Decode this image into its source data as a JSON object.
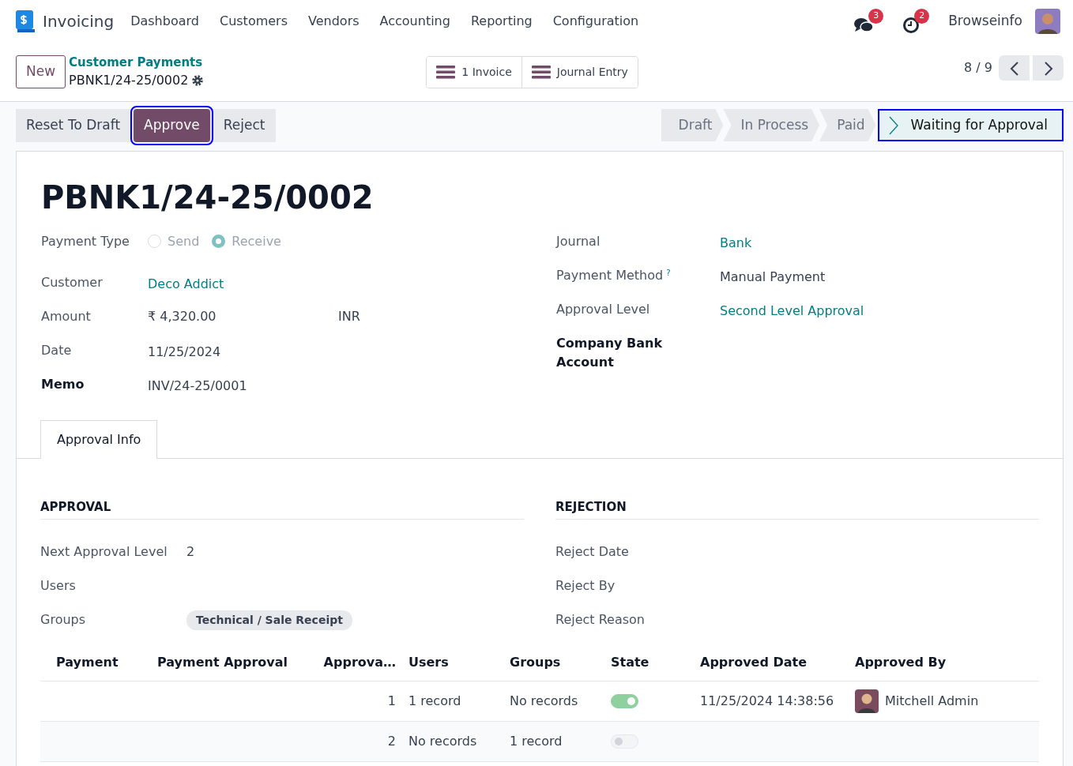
{
  "app": {
    "name": "Invoicing",
    "menu": [
      "Dashboard",
      "Customers",
      "Vendors",
      "Accounting",
      "Reporting",
      "Configuration"
    ]
  },
  "systray": {
    "messages_count": "3",
    "activities_count": "2",
    "company": "Browseinfo"
  },
  "control_panel": {
    "new_button": "New",
    "breadcrumb": "Customer Payments",
    "record": "PBNK1/24-25/0002",
    "smart_buttons": [
      "1 Invoice",
      "Journal Entry"
    ],
    "pager": "8 / 9"
  },
  "actions": [
    {
      "label": "Reset To Draft",
      "primary": false,
      "highlighted": false
    },
    {
      "label": "Approve",
      "primary": true,
      "highlighted": true
    },
    {
      "label": "Reject",
      "primary": false,
      "highlighted": false
    }
  ],
  "stages": [
    {
      "label": "Draft",
      "selected": false,
      "highlighted": false
    },
    {
      "label": "In Process",
      "selected": false,
      "highlighted": false
    },
    {
      "label": "Paid",
      "selected": false,
      "highlighted": false
    },
    {
      "label": "Waiting for Approval",
      "selected": true,
      "highlighted": true
    }
  ],
  "title": "PBNK1/24-25/0002",
  "left_fields": [
    {
      "kind": "radio",
      "label": "Payment Type",
      "options": [
        {
          "label": "Send",
          "selected": false
        },
        {
          "label": "Receive",
          "selected": true
        }
      ]
    },
    {
      "kind": "link",
      "label": "Customer",
      "value": "Deco Addict"
    },
    {
      "kind": "amount",
      "label": "Amount",
      "value": "₹ 4,320.00",
      "currency": "INR"
    },
    {
      "kind": "text",
      "label": "Date",
      "value": "11/25/2024"
    },
    {
      "kind": "text",
      "label": "Memo",
      "value": "INV/24-25/0001",
      "required": true
    }
  ],
  "right_fields": [
    {
      "kind": "link",
      "label": "Journal",
      "value": "Bank"
    },
    {
      "kind": "text",
      "label": "Payment Method",
      "help": "?",
      "value": "Manual Payment"
    },
    {
      "kind": "link",
      "label": "Approval Level",
      "value": "Second Level Approval"
    },
    {
      "kind": "text",
      "label": "Company Bank Account",
      "required": true
    }
  ],
  "tabs": [
    {
      "label": "Approval Info",
      "selected": true
    }
  ],
  "approval": {
    "heading": "APPROVAL",
    "fields": [
      {
        "label": "Next Approval Level",
        "value": "2"
      },
      {
        "label": "Users"
      },
      {
        "label": "Groups",
        "tags": [
          "Technical / Sale Receipt"
        ]
      }
    ]
  },
  "rejection": {
    "heading": "REJECTION",
    "fields": [
      {
        "label": "Reject Date"
      },
      {
        "label": "Reject By"
      },
      {
        "label": "Reject Reason"
      }
    ]
  },
  "table": {
    "columns": [
      "Payment",
      "Payment Approval",
      "Approva…",
      "Users",
      "Groups",
      "State",
      "Approved Date",
      "Approved By"
    ],
    "rows": [
      {
        "approval_level": "1",
        "users": "1 record",
        "groups": "No records",
        "state_on": true,
        "approved_date": "11/25/2024 14:38:56",
        "approved_by": "Mitchell Admin"
      },
      {
        "approval_level": "2",
        "users": "No records",
        "groups": "1 record",
        "state_on": false
      }
    ]
  }
}
